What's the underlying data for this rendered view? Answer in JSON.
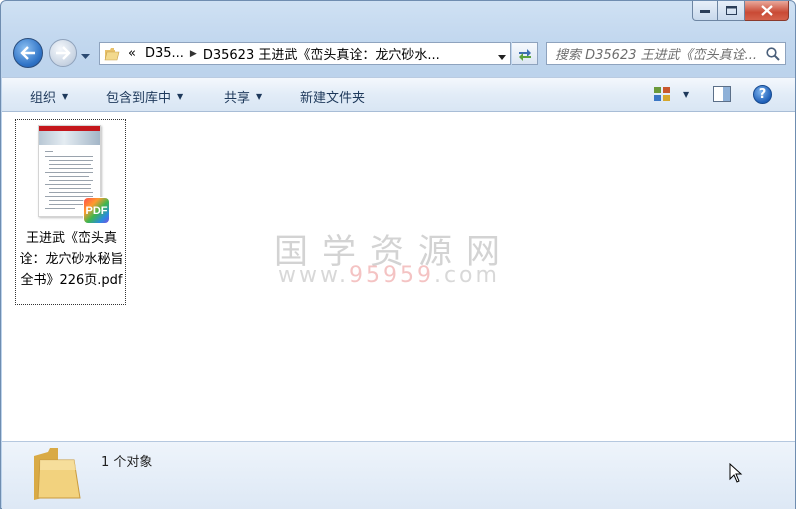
{
  "address": {
    "overflow": "«",
    "segment1": "D35...",
    "segment2": "D35623 王进武《峦头真诠：龙穴砂水..."
  },
  "search": {
    "placeholder": "搜索 D35623 王进武《峦头真诠..."
  },
  "commandbar": {
    "organize": "组织",
    "include_in_library": "包含到库中",
    "share": "共享",
    "new_folder": "新建文件夹",
    "help": "?"
  },
  "files": [
    {
      "name": "王进武《峦头真诠：龙穴砂水秘旨全书》226页.pdf",
      "badge": "PDF"
    }
  ],
  "watermark": {
    "title": "国学资源网",
    "url_prefix": "www.",
    "url_accent": "95959",
    "url_suffix": ".com"
  },
  "details": {
    "count_text": "1 个对象"
  },
  "colors": {
    "accent_blue": "#2f73c6",
    "close_red": "#c94a35",
    "thumb_red": "#c4161c"
  }
}
